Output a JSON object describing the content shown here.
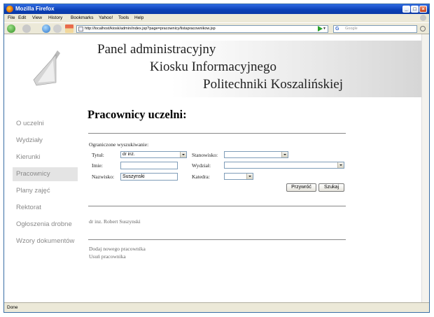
{
  "window": {
    "title": "Mozilla Firefox"
  },
  "menu": [
    "File",
    "Edit",
    "View",
    "History",
    "Bookmarks",
    "Yahoo!",
    "Tools",
    "Help"
  ],
  "address": {
    "url": "http://localhost/kiosk/admin/index.jsp?page=pracownicy/listapracownikow.jsp"
  },
  "search": {
    "placeholder": "Google",
    "engine": "G"
  },
  "banner": {
    "line1": "Panel administracyjny",
    "line2": "Kiosku Informacyjnego",
    "line3": "Politechniki Koszalińskiej"
  },
  "sidebar": [
    "O uczelni",
    "Wydziały",
    "Kierunki",
    "Pracownicy",
    "Plany zajęć",
    "Rektorat",
    "Ogłoszenia drobne",
    "Wzory dokumentów"
  ],
  "page": {
    "title": "Pracownicy uczelni:",
    "filter_label": "Ograniczone wyszukiwanie:",
    "labels": {
      "tytul": "Tytuł:",
      "imie": "Imie:",
      "nazwisko": "Nazwisko:",
      "stanowisko": "Stanowisko:",
      "wydzial": "Wydział:",
      "katedra": "Katedra:"
    },
    "values": {
      "tytul": "dr inz.",
      "imie": "",
      "nazwisko": "Suszynski",
      "stanowisko": "",
      "wydzial": "",
      "katedra": ""
    },
    "buttons": {
      "reset": "Przywróć",
      "search": "Szukaj"
    },
    "results": [
      "dr inz. Robert Suszynski"
    ],
    "actions": [
      "Dodaj nowego pracownika",
      "Usuń pracownika"
    ]
  },
  "status": {
    "text": "Done"
  }
}
